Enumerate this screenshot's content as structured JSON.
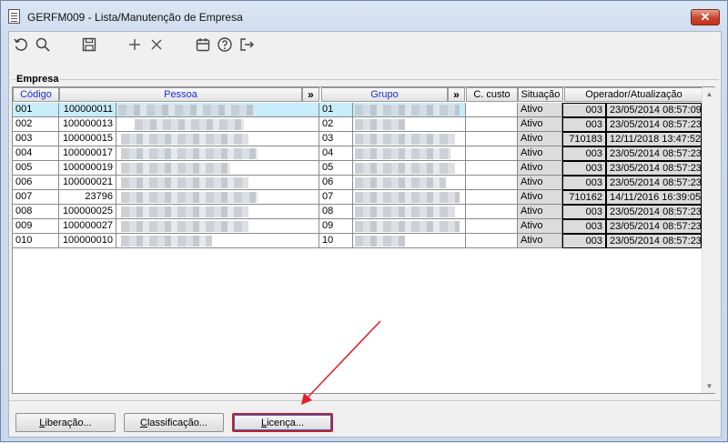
{
  "window": {
    "title": "GERFM009 - Lista/Manutenção de Empresa",
    "close_glyph": "✕"
  },
  "toolbar": {
    "icons": [
      "refresh-icon",
      "search-icon",
      "save-icon",
      "add-icon",
      "delete-icon",
      "calendar-icon",
      "help-icon",
      "exit-icon"
    ]
  },
  "group": {
    "label": "Empresa"
  },
  "grid": {
    "headers": {
      "codigo": "Código",
      "pessoa": "Pessoa",
      "expand1": "»",
      "grupo": "Grupo",
      "expand2": "»",
      "ccusto": "C. custo",
      "situacao": "Situação",
      "operador": "Operador/Atualização"
    },
    "rows": [
      {
        "codigo": "001",
        "pessoa": "100000011",
        "grupo": "01",
        "situacao": "Ativo",
        "operador": "003",
        "data": "23/05/2014 08:57:09"
      },
      {
        "codigo": "002",
        "pessoa": "100000013",
        "grupo": "02",
        "situacao": "Ativo",
        "operador": "003",
        "data": "23/05/2014 08:57:23"
      },
      {
        "codigo": "003",
        "pessoa": "100000015",
        "grupo": "03",
        "situacao": "Ativo",
        "operador": "710183",
        "data": "12/11/2018 13:47:52"
      },
      {
        "codigo": "004",
        "pessoa": "100000017",
        "grupo": "04",
        "situacao": "Ativo",
        "operador": "003",
        "data": "23/05/2014 08:57:23"
      },
      {
        "codigo": "005",
        "pessoa": "100000019",
        "grupo": "05",
        "situacao": "Ativo",
        "operador": "003",
        "data": "23/05/2014 08:57:23"
      },
      {
        "codigo": "006",
        "pessoa": "100000021",
        "grupo": "06",
        "situacao": "Ativo",
        "operador": "003",
        "data": "23/05/2014 08:57:23"
      },
      {
        "codigo": "007",
        "pessoa": "23796",
        "grupo": "07",
        "situacao": "Ativo",
        "operador": "710162",
        "data": "14/11/2016 16:39:05"
      },
      {
        "codigo": "008",
        "pessoa": "100000025",
        "grupo": "08",
        "situacao": "Ativo",
        "operador": "003",
        "data": "23/05/2014 08:57:23"
      },
      {
        "codigo": "009",
        "pessoa": "100000027",
        "grupo": "09",
        "situacao": "Ativo",
        "operador": "003",
        "data": "23/05/2014 08:57:23"
      },
      {
        "codigo": "010",
        "pessoa": "100000010",
        "grupo": "10",
        "situacao": "Ativo",
        "operador": "003",
        "data": "23/05/2014 08:57:23"
      }
    ]
  },
  "buttons": {
    "liberacao": {
      "first": "L",
      "rest": "iberação..."
    },
    "classificacao": {
      "first": "C",
      "rest": "lassificação..."
    },
    "licenca": {
      "first": "L",
      "rest": "icença..."
    }
  },
  "colors": {
    "selection": "#c9ecfa",
    "header_blue": "#1a2fd0",
    "annotation_red": "#e0202a"
  }
}
